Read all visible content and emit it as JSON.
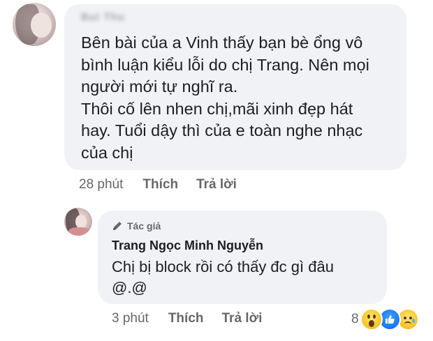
{
  "comment": {
    "author": "Bui Thu",
    "lines": [
      "Bên bài của a Vinh thấy bạn bè ổng vô",
      "bình luận kiểu lỗi do chị Trang. Nên mọi",
      "người mới tự nghĩ ra.",
      "Thôi cố lên nhen chị,mãi xinh đẹp hát",
      "hay. Tuổi dậy thì của e toàn nghe nhạc",
      "của chị"
    ],
    "time": "28 phút",
    "like_label": "Thích",
    "reply_label": "Trả lời"
  },
  "reply": {
    "badge": "Tác giả",
    "badge_icon": "pencil-icon",
    "author": "Trang Ngọc Minh Nguyễn",
    "lines": [
      "Chị bị block rồi có thấy đc gì đâu",
      "@.@"
    ],
    "time": "3 phút",
    "like_label": "Thích",
    "reply_label": "Trả lời",
    "reaction_count": "8",
    "reactions": [
      "wow-icon",
      "like-icon",
      "sad-icon"
    ]
  },
  "colors": {
    "bubble": "#f0f2f5",
    "text": "#1c1e21",
    "meta": "#65676b",
    "like_blue": "#1877f2"
  }
}
